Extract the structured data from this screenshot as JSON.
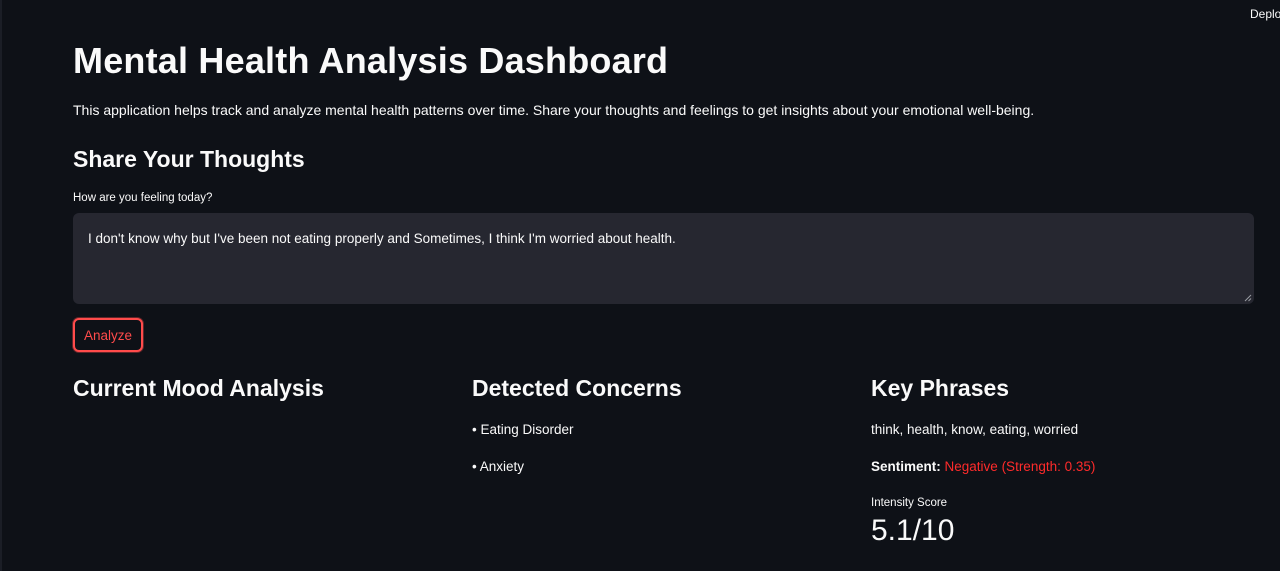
{
  "header": {
    "deploy_label": "Deplo"
  },
  "page": {
    "title": "Mental Health Analysis Dashboard",
    "intro": "This application helps track and analyze mental health patterns over time. Share your thoughts and feelings to get insights about your emotional well-being."
  },
  "share": {
    "title": "Share Your Thoughts",
    "input_label": "How are you feeling today?",
    "input_value": "I don't know why but I've been not eating properly and Sometimes, I think I'm worried about health.",
    "analyze_label": "Analyze"
  },
  "mood": {
    "title": "Current Mood Analysis"
  },
  "concerns": {
    "title": "Detected Concerns",
    "items": [
      "• Eating Disorder",
      "• Anxiety"
    ]
  },
  "key_phrases": {
    "title": "Key Phrases",
    "phrases": "think, health, know, eating, worried",
    "sentiment_label": "Sentiment:",
    "sentiment_value": "Negative (Strength: 0.35)",
    "intensity_label": "Intensity Score",
    "intensity_value": "5.1/10"
  },
  "colors": {
    "background": "#0e1117",
    "input_background": "#262730",
    "accent": "#ff4b4b",
    "negative": "#ff2b2b",
    "text": "#fafafa"
  }
}
